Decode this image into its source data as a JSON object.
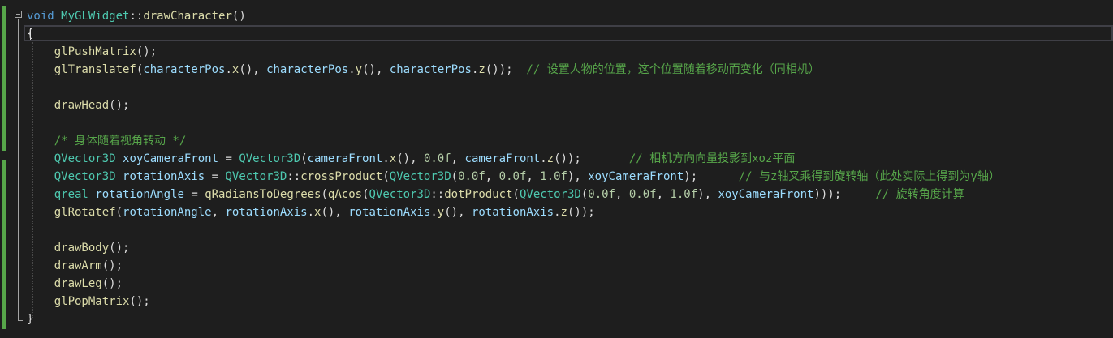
{
  "editor": {
    "lines": [
      {
        "tokens": [
          {
            "t": "void",
            "c": "kw"
          },
          {
            "t": " ",
            "c": "pl"
          },
          {
            "t": "MyGLWidget",
            "c": "ty"
          },
          {
            "t": "::",
            "c": "pl"
          },
          {
            "t": "drawCharacter",
            "c": "fn"
          },
          {
            "t": "()",
            "c": "pl"
          }
        ]
      },
      {
        "tokens": [
          {
            "t": "{",
            "c": "pl"
          }
        ]
      },
      {
        "tokens": [
          {
            "t": "    ",
            "c": "pl"
          },
          {
            "t": "glPushMatrix",
            "c": "fn"
          },
          {
            "t": "();",
            "c": "pl"
          }
        ]
      },
      {
        "tokens": [
          {
            "t": "    ",
            "c": "pl"
          },
          {
            "t": "glTranslatef",
            "c": "fn"
          },
          {
            "t": "(",
            "c": "pl"
          },
          {
            "t": "characterPos",
            "c": "vr"
          },
          {
            "t": ".",
            "c": "pl"
          },
          {
            "t": "x",
            "c": "fn"
          },
          {
            "t": "(), ",
            "c": "pl"
          },
          {
            "t": "characterPos",
            "c": "vr"
          },
          {
            "t": ".",
            "c": "pl"
          },
          {
            "t": "y",
            "c": "fn"
          },
          {
            "t": "(), ",
            "c": "pl"
          },
          {
            "t": "characterPos",
            "c": "vr"
          },
          {
            "t": ".",
            "c": "pl"
          },
          {
            "t": "z",
            "c": "fn"
          },
          {
            "t": "());  ",
            "c": "pl"
          },
          {
            "t": "// 设置人物的位置，这个位置随着移动而变化（同相机）",
            "c": "cm"
          }
        ]
      },
      {
        "tokens": []
      },
      {
        "tokens": [
          {
            "t": "    ",
            "c": "pl"
          },
          {
            "t": "drawHead",
            "c": "fn"
          },
          {
            "t": "();",
            "c": "pl"
          }
        ]
      },
      {
        "tokens": []
      },
      {
        "tokens": [
          {
            "t": "    ",
            "c": "pl"
          },
          {
            "t": "/* 身体随着视角转动 */",
            "c": "cm"
          }
        ]
      },
      {
        "tokens": [
          {
            "t": "    ",
            "c": "pl"
          },
          {
            "t": "QVector3D",
            "c": "ty"
          },
          {
            "t": " ",
            "c": "pl"
          },
          {
            "t": "xoyCameraFront",
            "c": "vr"
          },
          {
            "t": " = ",
            "c": "pl"
          },
          {
            "t": "QVector3D",
            "c": "ty"
          },
          {
            "t": "(",
            "c": "pl"
          },
          {
            "t": "cameraFront",
            "c": "vr"
          },
          {
            "t": ".",
            "c": "pl"
          },
          {
            "t": "x",
            "c": "fn"
          },
          {
            "t": "(), ",
            "c": "pl"
          },
          {
            "t": "0.0f",
            "c": "num"
          },
          {
            "t": ", ",
            "c": "pl"
          },
          {
            "t": "cameraFront",
            "c": "vr"
          },
          {
            "t": ".",
            "c": "pl"
          },
          {
            "t": "z",
            "c": "fn"
          },
          {
            "t": "());       ",
            "c": "pl"
          },
          {
            "t": "// 相机方向向量投影到xoz平面",
            "c": "cm"
          }
        ]
      },
      {
        "tokens": [
          {
            "t": "    ",
            "c": "pl"
          },
          {
            "t": "QVector3D",
            "c": "ty"
          },
          {
            "t": " ",
            "c": "pl"
          },
          {
            "t": "rotationAxis",
            "c": "vr"
          },
          {
            "t": " = ",
            "c": "pl"
          },
          {
            "t": "QVector3D",
            "c": "ty"
          },
          {
            "t": "::",
            "c": "pl"
          },
          {
            "t": "crossProduct",
            "c": "fn"
          },
          {
            "t": "(",
            "c": "pl"
          },
          {
            "t": "QVector3D",
            "c": "ty"
          },
          {
            "t": "(",
            "c": "pl"
          },
          {
            "t": "0.0f",
            "c": "num"
          },
          {
            "t": ", ",
            "c": "pl"
          },
          {
            "t": "0.0f",
            "c": "num"
          },
          {
            "t": ", ",
            "c": "pl"
          },
          {
            "t": "1.0f",
            "c": "num"
          },
          {
            "t": "), ",
            "c": "pl"
          },
          {
            "t": "xoyCameraFront",
            "c": "vr"
          },
          {
            "t": ");      ",
            "c": "pl"
          },
          {
            "t": "// 与z轴叉乘得到旋转轴（此处实际上得到为y轴）",
            "c": "cm"
          }
        ]
      },
      {
        "tokens": [
          {
            "t": "    ",
            "c": "pl"
          },
          {
            "t": "qreal",
            "c": "ty"
          },
          {
            "t": " ",
            "c": "pl"
          },
          {
            "t": "rotationAngle",
            "c": "vr"
          },
          {
            "t": " = ",
            "c": "pl"
          },
          {
            "t": "qRadiansToDegrees",
            "c": "fn"
          },
          {
            "t": "(",
            "c": "pl"
          },
          {
            "t": "qAcos",
            "c": "fn"
          },
          {
            "t": "(",
            "c": "pl"
          },
          {
            "t": "QVector3D",
            "c": "ty"
          },
          {
            "t": "::",
            "c": "pl"
          },
          {
            "t": "dotProduct",
            "c": "fn"
          },
          {
            "t": "(",
            "c": "pl"
          },
          {
            "t": "QVector3D",
            "c": "ty"
          },
          {
            "t": "(",
            "c": "pl"
          },
          {
            "t": "0.0f",
            "c": "num"
          },
          {
            "t": ", ",
            "c": "pl"
          },
          {
            "t": "0.0f",
            "c": "num"
          },
          {
            "t": ", ",
            "c": "pl"
          },
          {
            "t": "1.0f",
            "c": "num"
          },
          {
            "t": "), ",
            "c": "pl"
          },
          {
            "t": "xoyCameraFront",
            "c": "vr"
          },
          {
            "t": ")));     ",
            "c": "pl"
          },
          {
            "t": "// 旋转角度计算",
            "c": "cm"
          }
        ]
      },
      {
        "tokens": [
          {
            "t": "    ",
            "c": "pl"
          },
          {
            "t": "glRotatef",
            "c": "fn"
          },
          {
            "t": "(",
            "c": "pl"
          },
          {
            "t": "rotationAngle",
            "c": "vr"
          },
          {
            "t": ", ",
            "c": "pl"
          },
          {
            "t": "rotationAxis",
            "c": "vr"
          },
          {
            "t": ".",
            "c": "pl"
          },
          {
            "t": "x",
            "c": "fn"
          },
          {
            "t": "(), ",
            "c": "pl"
          },
          {
            "t": "rotationAxis",
            "c": "vr"
          },
          {
            "t": ".",
            "c": "pl"
          },
          {
            "t": "y",
            "c": "fn"
          },
          {
            "t": "(), ",
            "c": "pl"
          },
          {
            "t": "rotationAxis",
            "c": "vr"
          },
          {
            "t": ".",
            "c": "pl"
          },
          {
            "t": "z",
            "c": "fn"
          },
          {
            "t": "());",
            "c": "pl"
          }
        ]
      },
      {
        "tokens": []
      },
      {
        "tokens": [
          {
            "t": "    ",
            "c": "pl"
          },
          {
            "t": "drawBody",
            "c": "fn"
          },
          {
            "t": "();",
            "c": "pl"
          }
        ]
      },
      {
        "tokens": [
          {
            "t": "    ",
            "c": "pl"
          },
          {
            "t": "drawArm",
            "c": "fn"
          },
          {
            "t": "();",
            "c": "pl"
          }
        ]
      },
      {
        "tokens": [
          {
            "t": "    ",
            "c": "pl"
          },
          {
            "t": "drawLeg",
            "c": "fn"
          },
          {
            "t": "();",
            "c": "pl"
          }
        ]
      },
      {
        "tokens": [
          {
            "t": "    ",
            "c": "pl"
          },
          {
            "t": "glPopMatrix",
            "c": "fn"
          },
          {
            "t": "();",
            "c": "pl"
          }
        ]
      },
      {
        "tokens": [
          {
            "t": "}",
            "c": "pl"
          }
        ]
      }
    ]
  }
}
